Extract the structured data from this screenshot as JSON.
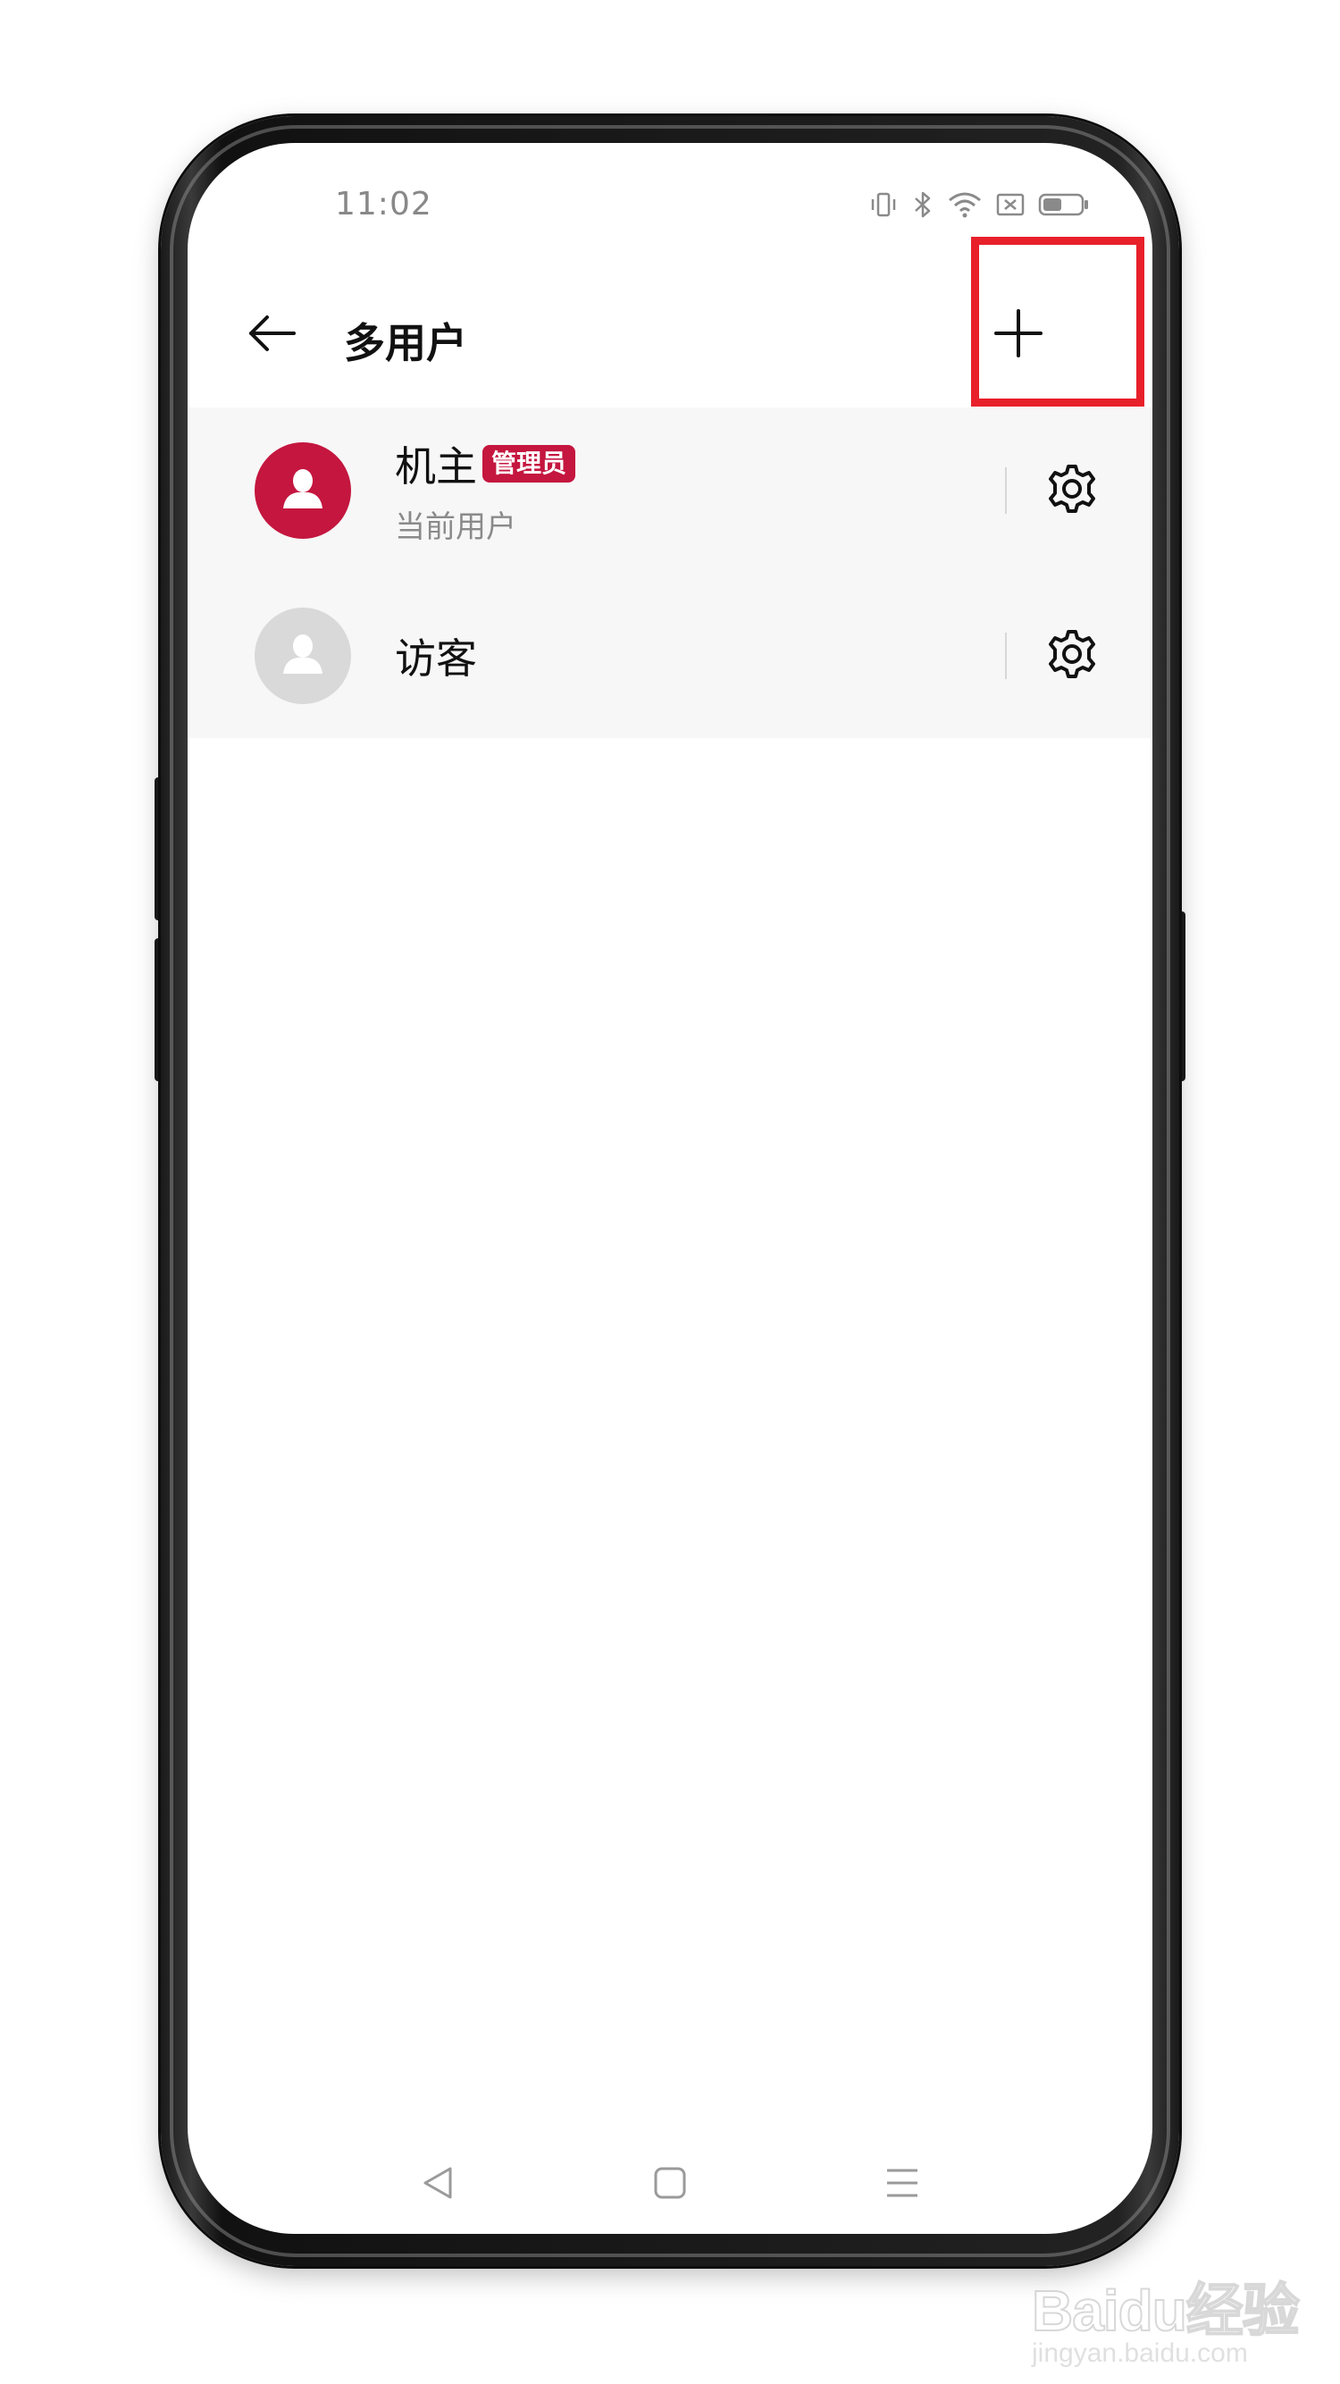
{
  "status_bar": {
    "time": "11:02",
    "icons": [
      "vibrate-icon",
      "bluetooth-icon",
      "wifi-icon",
      "sim-off-icon",
      "battery-icon"
    ]
  },
  "app_bar": {
    "title": "多用户",
    "back_icon": "arrow-left-icon",
    "add_icon": "plus-icon",
    "highlight_color": "#e8202a"
  },
  "users": [
    {
      "name": "机主",
      "badge": "管理员",
      "subtitle": "当前用户",
      "avatar_color": "#c4163f",
      "settings_icon": "gear-icon"
    },
    {
      "name": "访客",
      "avatar_color": "#d9d9d9",
      "settings_icon": "gear-icon"
    }
  ],
  "nav_bar": {
    "icons": [
      "nav-back-icon",
      "nav-home-icon",
      "nav-recents-icon"
    ]
  },
  "watermark": {
    "logo": "Baidu经验",
    "url": "jingyan.baidu.com"
  },
  "colors": {
    "accent": "#c4163f",
    "list_background": "#f7f7f7"
  }
}
